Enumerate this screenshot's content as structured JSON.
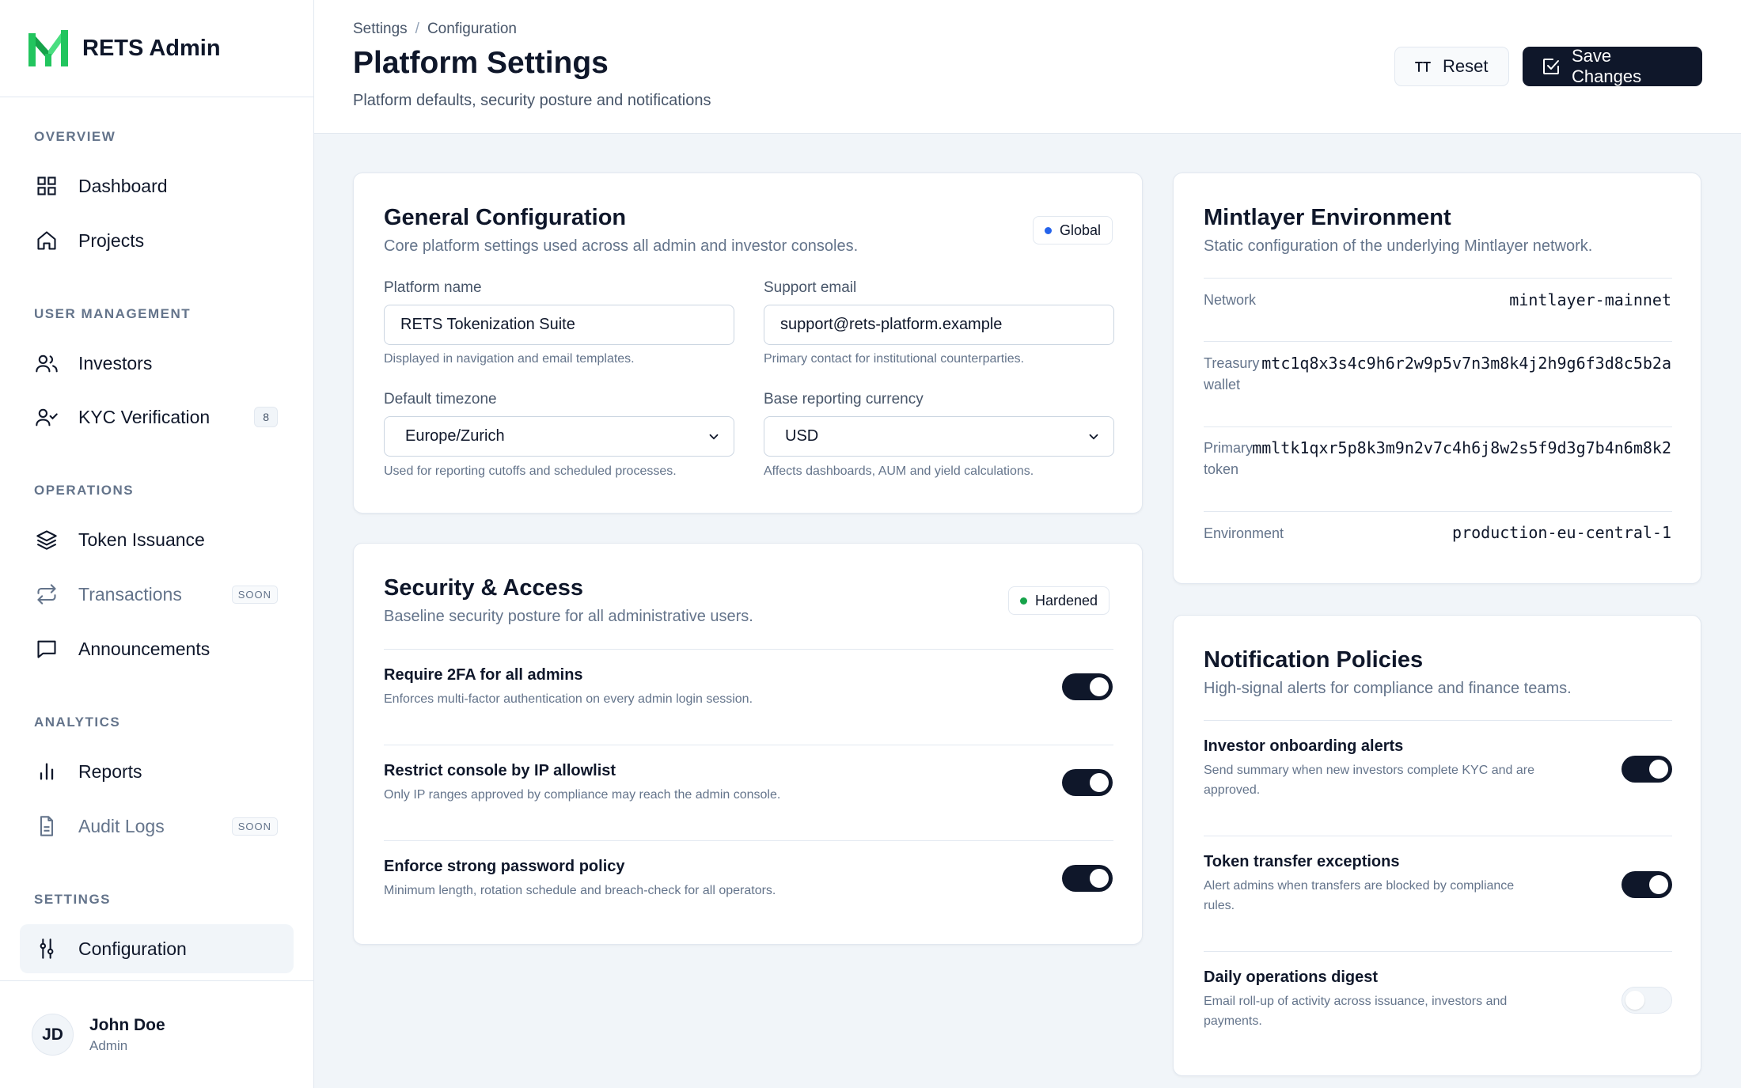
{
  "brand": {
    "name": "RETS Admin",
    "logo_color": "#22c55e"
  },
  "sidebar": {
    "sections": {
      "overview": "OVERVIEW",
      "user_management": "USER MANAGEMENT",
      "operations": "OPERATIONS",
      "analytics": "ANALYTICS",
      "settings": "SETTINGS"
    },
    "items": {
      "dashboard": "Dashboard",
      "projects": "Projects",
      "investors": "Investors",
      "kyc": "KYC Verification",
      "kyc_badge": "8",
      "token_issuance": "Token Issuance",
      "transactions": "Transactions",
      "transactions_badge": "SOON",
      "announcements": "Announcements",
      "reports": "Reports",
      "audit_logs": "Audit Logs",
      "audit_logs_badge": "SOON",
      "configuration": "Configuration"
    },
    "user": {
      "initials": "JD",
      "name": "John Doe",
      "role": "Admin"
    }
  },
  "header": {
    "breadcrumb": [
      "Settings",
      "Configuration"
    ],
    "breadcrumb_sep": "/",
    "title": "Platform Settings",
    "subtitle": "Platform defaults, security posture and notifications",
    "reset_label": "Reset",
    "save_label": "Save Changes"
  },
  "general": {
    "title": "General Configuration",
    "subtitle": "Core platform settings used across all admin and investor consoles.",
    "badge": "Global",
    "badge_color": "#2563eb",
    "platform_name": {
      "label": "Platform name",
      "value": "RETS Tokenization Suite",
      "hint": "Displayed in navigation and email templates."
    },
    "support_email": {
      "label": "Support email",
      "value": "support@rets-platform.example",
      "hint": "Primary contact for institutional counterparties."
    },
    "timezone": {
      "label": "Default timezone",
      "value": "Europe/Zurich",
      "hint": "Used for reporting cutoffs and scheduled processes."
    },
    "currency": {
      "label": "Base reporting currency",
      "value": "USD",
      "hint": "Affects dashboards, AUM and yield calculations."
    }
  },
  "security": {
    "title": "Security & Access",
    "subtitle": "Baseline security posture for all administrative users.",
    "badge": "Hardened",
    "badge_color": "#16a34a",
    "rows": [
      {
        "title": "Require 2FA for all admins",
        "desc": "Enforces multi-factor authentication on every admin login session.",
        "enabled": true
      },
      {
        "title": "Restrict console by IP allowlist",
        "desc": "Only IP ranges approved by compliance may reach the admin console.",
        "enabled": true
      },
      {
        "title": "Enforce strong password policy",
        "desc": "Minimum length, rotation schedule and breach-check for all operators.",
        "enabled": true
      }
    ]
  },
  "mintlayer": {
    "title": "Mintlayer Environment",
    "subtitle": "Static configuration of the underlying Mintlayer network.",
    "rows": [
      {
        "key": "Network",
        "value": "mintlayer-mainnet"
      },
      {
        "key_line1": "Treasury",
        "key_line2": "wallet",
        "value": "mtc1q8x3s4c9h6r2w9p5v7n3m8k4j2h9g6f3d8c5b2a"
      },
      {
        "key_line1": "Primary",
        "key_line2": "token",
        "value": "mmltk1qxr5p8k3m9n2v7c4h6j8w2s5f9d3g7b4n6m8k2"
      },
      {
        "key": "Environment",
        "value": "production-eu-central-1"
      }
    ]
  },
  "notifications": {
    "title": "Notification Policies",
    "subtitle": "High-signal alerts for compliance and finance teams.",
    "rows": [
      {
        "title": "Investor onboarding alerts",
        "desc1": "Send summary when new investors complete KYC and are",
        "desc2": "approved.",
        "enabled": true
      },
      {
        "title": "Token transfer exceptions",
        "desc1": "Alert admins when transfers are blocked by compliance",
        "desc2": "rules.",
        "enabled": true
      },
      {
        "title": "Daily operations digest",
        "desc1": "Email roll-up of activity across issuance, investors and",
        "desc2": "payments.",
        "enabled": false
      }
    ]
  }
}
